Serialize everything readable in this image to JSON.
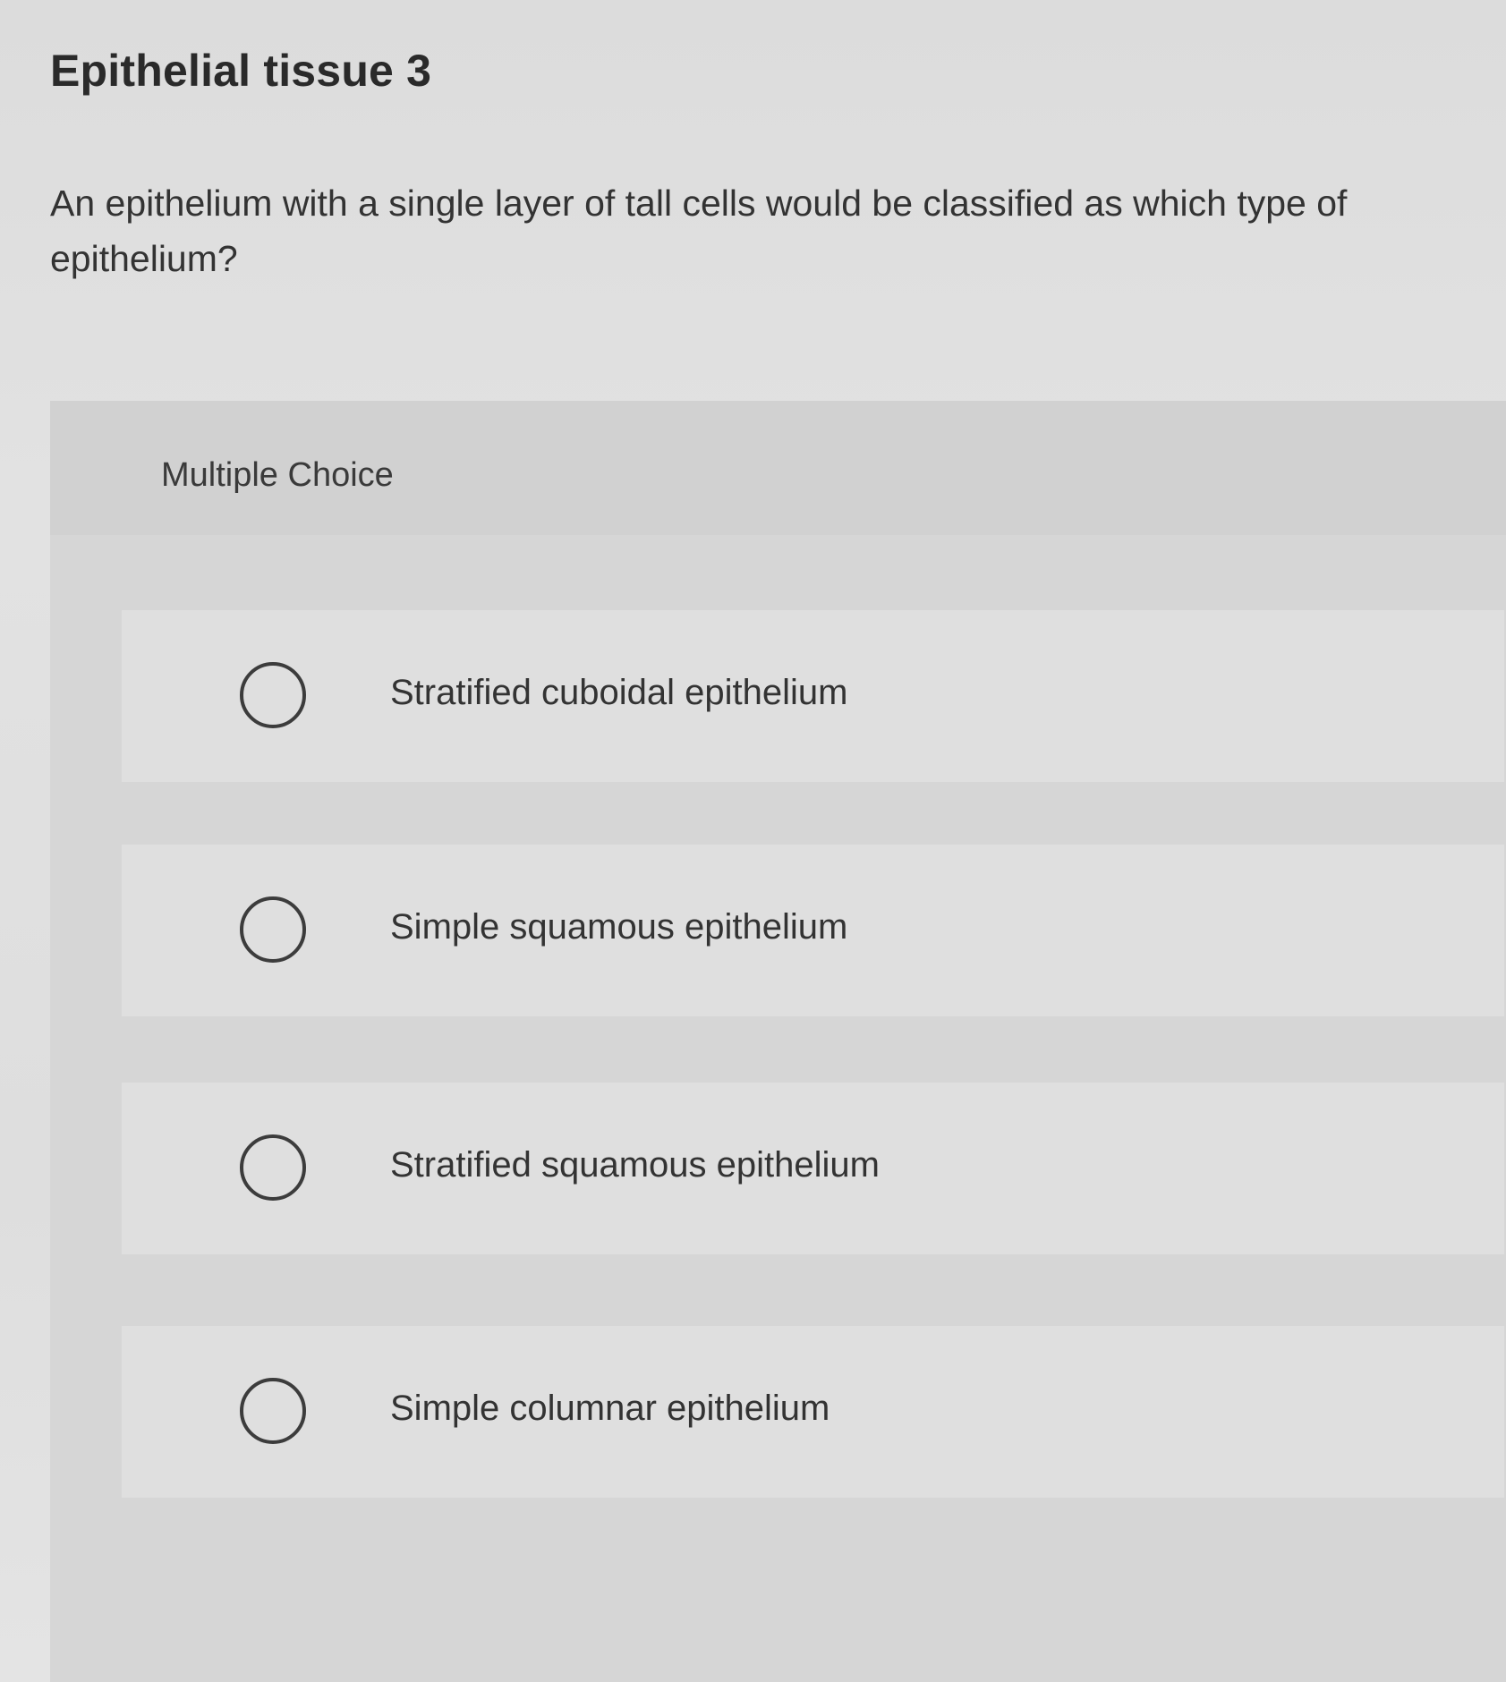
{
  "page": {
    "title": "Epithelial tissue 3",
    "question": "An epithelium with a single layer of tall cells would be classified as which type of epithelium?"
  },
  "multiple_choice": {
    "label": "Multiple Choice",
    "options": [
      {
        "label": "Stratified cuboidal epithelium",
        "selected": false
      },
      {
        "label": "Simple squamous epithelium",
        "selected": false
      },
      {
        "label": "Stratified squamous epithelium",
        "selected": false
      },
      {
        "label": "Simple columnar epithelium",
        "selected": false
      }
    ]
  },
  "colors": {
    "background": "#dcdcdc",
    "panel": "#d6d6d6",
    "option_card": "#dfdfdf",
    "text": "#2e2e2e",
    "radio_border": "#3c3c3c"
  }
}
